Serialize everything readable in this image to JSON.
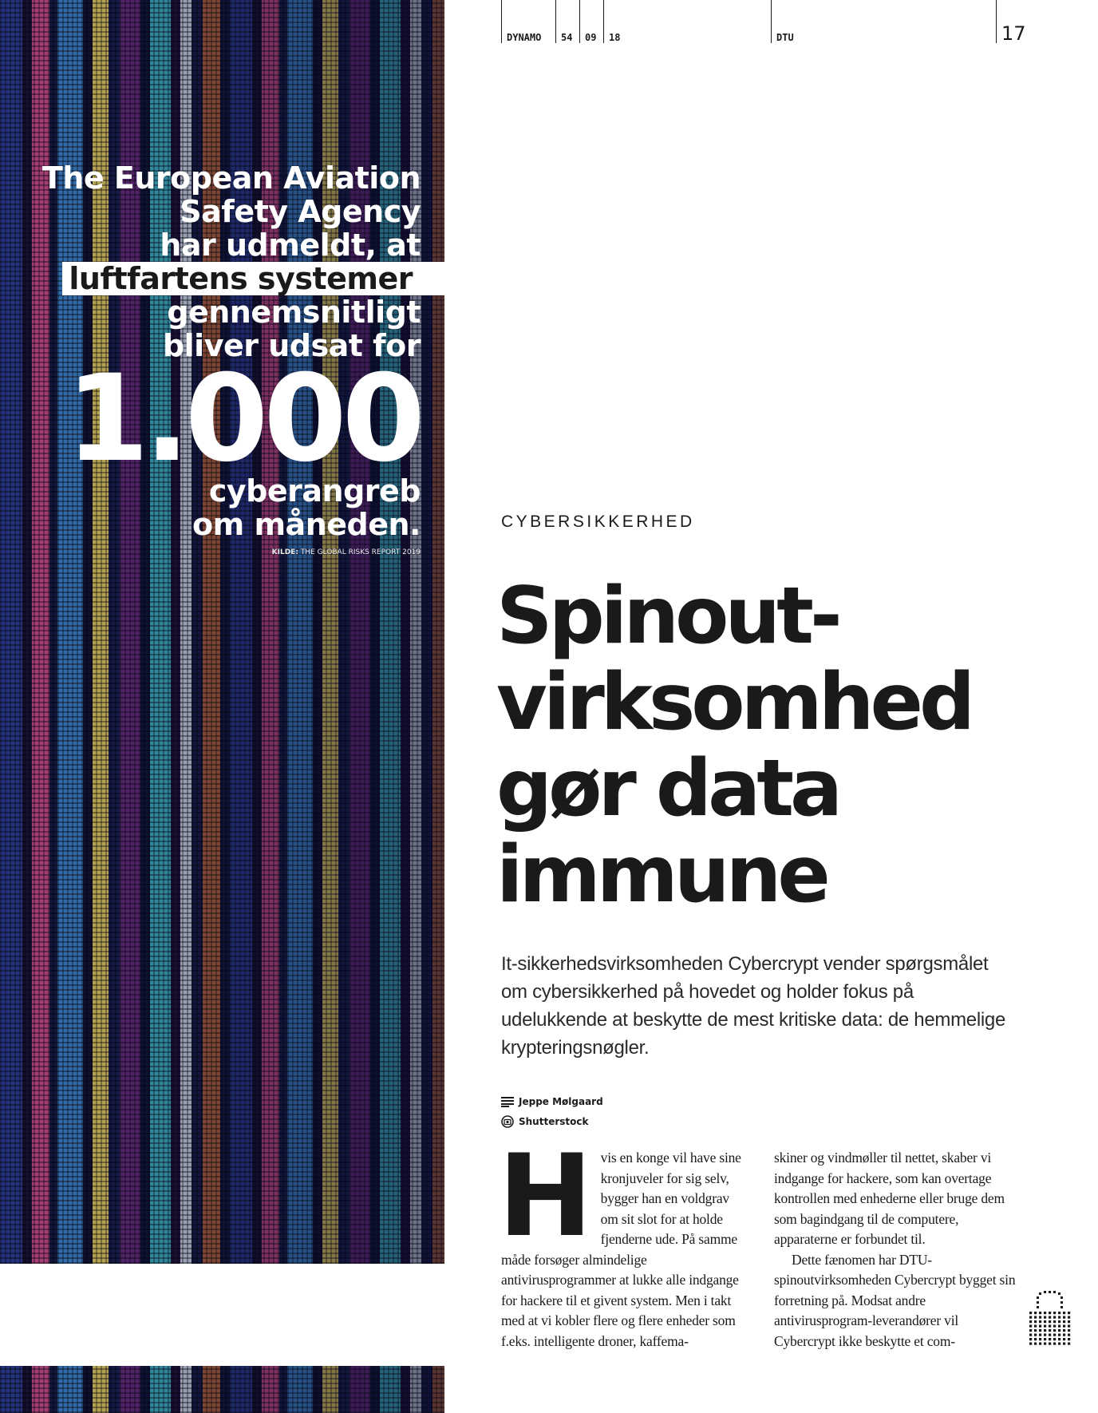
{
  "header": {
    "magazine": "DYNAMO",
    "issue": "54",
    "month": "09",
    "year": "18",
    "section": "DTU",
    "page_number": "17"
  },
  "sidebar_quote": {
    "lines": [
      "The European Aviation",
      "Safety Agency",
      "har udmeldt, at"
    ],
    "highlight": "luftfartens systemer",
    "lines2": [
      "gennemsnitligt",
      "bliver udsat for"
    ],
    "big_number": "1.000",
    "lines3": [
      "cyberangreb",
      "om måneden."
    ],
    "source_label": "KILDE:",
    "source_text": "THE GLOBAL RISKS REPORT 2019"
  },
  "article": {
    "kicker": "CYBERSIKKERHED",
    "headline_lines": [
      "Spinout-",
      "virksomhed",
      "gør data",
      "immune"
    ],
    "lead": "It-sikkerhedsvirksomheden Cybercrypt vender spørgsmålet om cybersikkerhed på hovedet og holder fokus på udelukkende at beskytte de mest kritiske data: de hemmelige krypteringsnøgler.",
    "author": "Jeppe Mølgaard",
    "photo_credit": "Shutterstock",
    "dropcap": "H",
    "col1_text": "vis en konge vil have sine kronjuveler for sig selv, bygger han en voldgrav om sit slot for at holde fjenderne ude. På samme måde forsøger almindelige antivirusprogrammer at lukke alle indgange for hackere til et givent system. Men i takt med at vi kobler flere og flere enheder som f.eks. intelligente droner, kaffema-",
    "col2_p1": "skiner og vindmøller til nettet, skaber vi indgange for hackere, som kan overtage kontrollen med enhederne eller bruge dem som bagindgang til de computere, apparaterne er forbundet til.",
    "col2_p2": "Dette fænomen har DTU-spinoutvirksomheden Cybercrypt bygget sin forretning på. Modsat andre antivirusprogram-leverandører vil Cybercrypt ikke beskytte et com-"
  },
  "icons": {
    "author": "lines-icon",
    "photo": "camera-icon",
    "end": "padlock-icon"
  },
  "colors": {
    "text": "#1a1a1a",
    "quote_text": "#ffffff"
  }
}
